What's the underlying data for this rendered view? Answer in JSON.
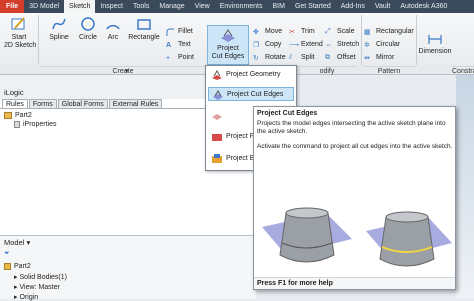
{
  "tabs": {
    "file": "File",
    "items": [
      "3D Model",
      "Sketch",
      "Inspect",
      "Tools",
      "Manage",
      "View",
      "Environments",
      "BIM",
      "Get Started",
      "Add-Ins",
      "Vault",
      "Autodesk A360"
    ],
    "active": "Sketch"
  },
  "ribbon": {
    "start_sketch": "Start\n2D Sketch",
    "spline": "Spline",
    "circle": "Circle",
    "arc": "Arc",
    "rectangle": "Rectangle",
    "fillet": "Fillet",
    "text": "Text",
    "point": "Point",
    "project_geometry_btn": "Project\nCut Edges",
    "move": "Move",
    "copy": "Copy",
    "rotate": "Rotate",
    "trim": "Trim",
    "extend": "Extend",
    "split": "Split",
    "scale": "Scale",
    "stretch": "Stretch",
    "offset": "Offset",
    "rectangular": "Rectangular",
    "circular": "Circular",
    "mirror": "Mirror",
    "dimension": "Dimension",
    "groups": {
      "create": "Create",
      "modify": "odify",
      "pattern": "Pattern",
      "constrain": "Constra"
    }
  },
  "ilogic": {
    "title": "iLogic",
    "tabs": [
      "Rules",
      "Forms",
      "Global Forms",
      "External Rules"
    ],
    "tree": [
      "Part2",
      "iProperties"
    ]
  },
  "model": {
    "title": "Model",
    "tree": [
      "Part2",
      "Solid Bodies(1)",
      "View: Master",
      "Origin"
    ]
  },
  "dropdown": {
    "items": [
      "Project Geometry",
      "Project Cut Edges",
      "",
      "Project F",
      "Project E"
    ]
  },
  "tooltip": {
    "title": "Project Cut Edges",
    "desc1": "Projects the model edges intersecting the active sketch plane into the active sketch.",
    "desc2": "Activate the command to project all cut edges into the active sketch.",
    "footer": "Press F1 for more help"
  },
  "colors": {
    "file_tab": "#d43d2a",
    "tabbar": "#3b4a5a",
    "highlight": "#cde6f7",
    "cone": "#9aa0a6",
    "plane": "#8a8fd6",
    "edge": "#f2d640"
  }
}
